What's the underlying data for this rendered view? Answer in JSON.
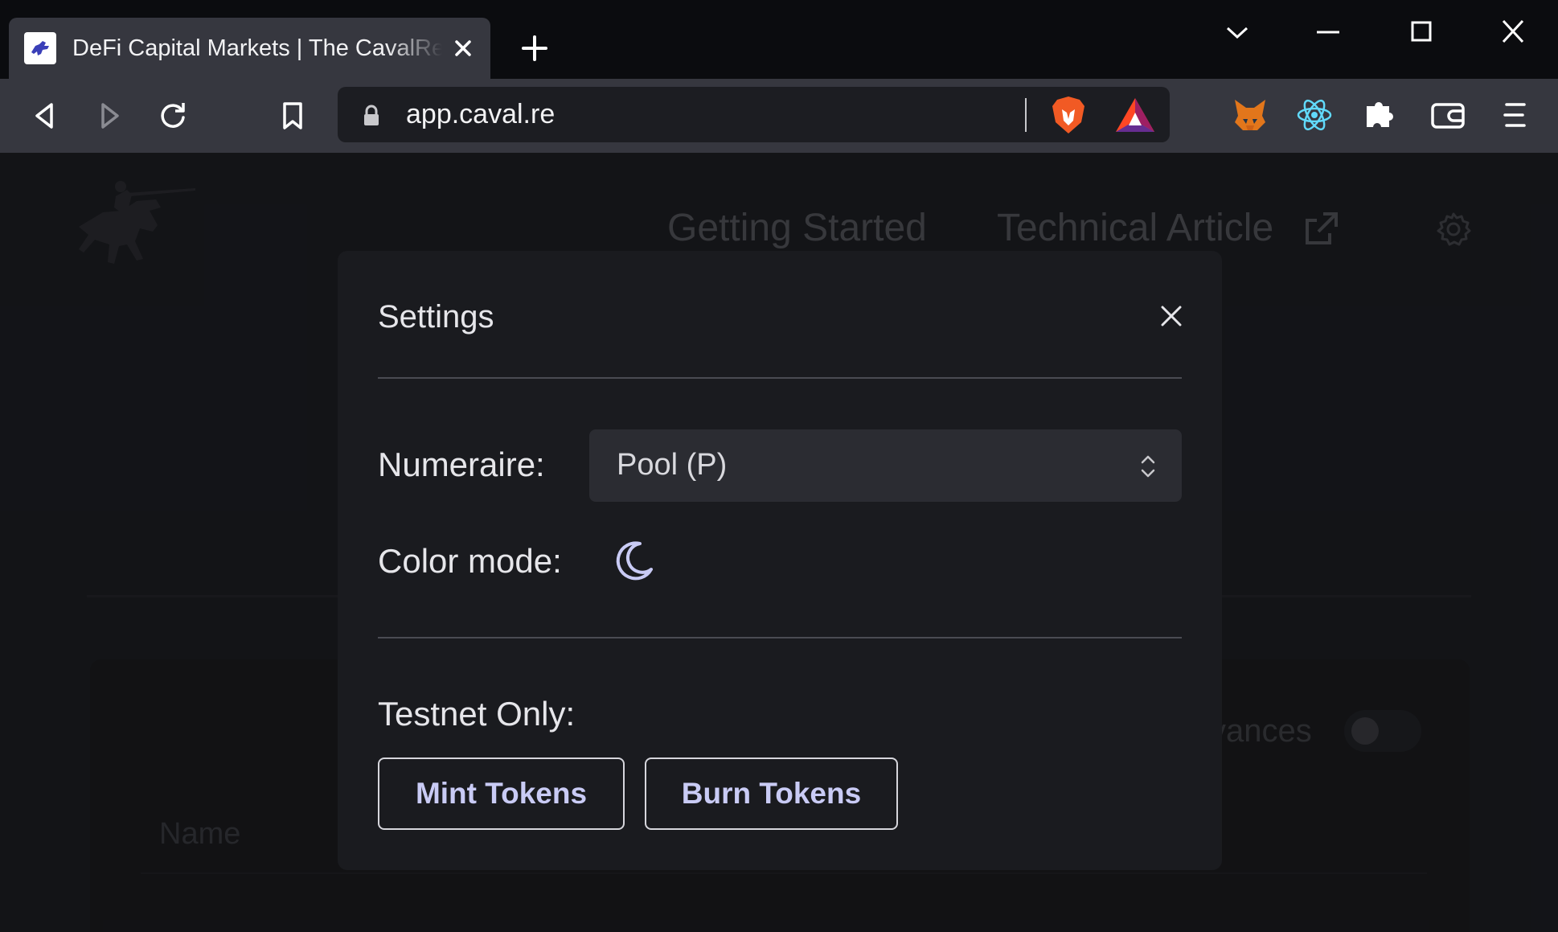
{
  "browser": {
    "tab": {
      "title": "DeFi Capital Markets | The CavalRe",
      "favicon": "cavalre-horse-icon"
    },
    "url": "app.caval.re",
    "icons": {
      "back": "back-arrow-icon",
      "forward": "forward-arrow-icon",
      "reload": "reload-icon",
      "bookmark": "bookmark-icon",
      "lock": "lock-icon",
      "brave_shields": "brave-lion-icon",
      "brave_rewards": "bat-triangle-icon",
      "metamask": "metamask-fox-icon",
      "react_devtools": "react-icon",
      "extensions": "puzzle-icon",
      "wallet": "wallet-icon",
      "menu": "hamburger-menu-icon"
    }
  },
  "page": {
    "nav": {
      "getting_started": "Getting Started",
      "technical_article": "Technical Article"
    },
    "table_header_name": "Name",
    "advances_label_fragment": "vances"
  },
  "settings_modal": {
    "title": "Settings",
    "numeraire_label": "Numeraire:",
    "numeraire_value": "Pool (P)",
    "color_mode_label": "Color mode:",
    "color_mode_icon": "moon-icon",
    "testnet_label": "Testnet Only:",
    "mint_button": "Mint Tokens",
    "burn_button": "Burn Tokens"
  },
  "colors": {
    "modal_bg": "#1a1b1f",
    "button_text": "#c9cbf5",
    "moon_accent": "#c9cbf5",
    "toolbar": "#36373f"
  }
}
